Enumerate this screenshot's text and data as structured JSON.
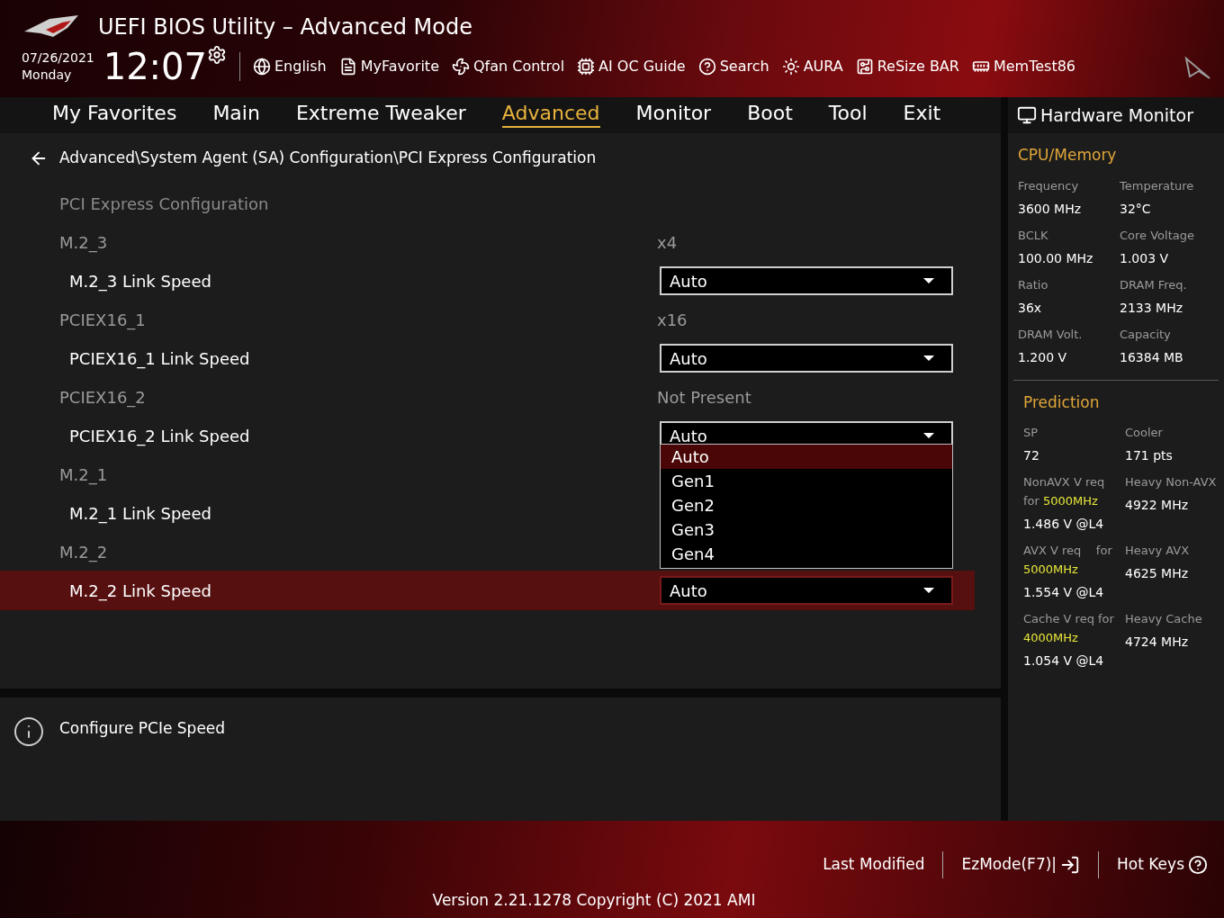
{
  "window": {
    "title": "UEFI BIOS Utility – Advanced Mode"
  },
  "clock": {
    "date": "07/26/2021",
    "weekday": "Monday",
    "time": "12:07"
  },
  "toolbar": [
    {
      "kind": "language",
      "label": "English"
    },
    {
      "kind": "favorite",
      "label": "MyFavorite"
    },
    {
      "kind": "fan",
      "label": "Qfan Control"
    },
    {
      "kind": "guide",
      "label": "AI OC Guide"
    },
    {
      "kind": "search",
      "label": "Search"
    },
    {
      "kind": "aura",
      "label": "AURA"
    },
    {
      "kind": "resize",
      "label": "ReSize BAR"
    },
    {
      "kind": "memtest",
      "label": "MemTest86"
    }
  ],
  "tabs": [
    {
      "label": "My Favorites",
      "selected": false
    },
    {
      "label": "Main",
      "selected": false
    },
    {
      "label": "Extreme Tweaker",
      "selected": false
    },
    {
      "label": "Advanced",
      "selected": true
    },
    {
      "label": "Monitor",
      "selected": false
    },
    {
      "label": "Boot",
      "selected": false
    },
    {
      "label": "Tool",
      "selected": false
    },
    {
      "label": "Exit",
      "selected": false
    }
  ],
  "breadcrumb": "Advanced\\System Agent (SA) Configuration\\PCI Express Configuration",
  "items": [
    {
      "kind": "title",
      "label": "PCI Express Configuration"
    },
    {
      "kind": "info",
      "label": "M.2_3",
      "value": "x4"
    },
    {
      "kind": "select",
      "label": "M.2_3 Link Speed",
      "value": "Auto",
      "selected": false
    },
    {
      "kind": "info",
      "label": "PCIEX16_1",
      "value": "x16"
    },
    {
      "kind": "select",
      "label": "PCIEX16_1 Link Speed",
      "value": "Auto",
      "selected": false
    },
    {
      "kind": "info",
      "label": "PCIEX16_2",
      "value": "Not Present"
    },
    {
      "kind": "select",
      "label": "PCIEX16_2 Link Speed",
      "value": "Auto",
      "selected": false,
      "options": [
        {
          "label": "Auto",
          "selected": true
        },
        {
          "label": "Gen1",
          "selected": false
        },
        {
          "label": "Gen2",
          "selected": false
        },
        {
          "label": "Gen3",
          "selected": false
        },
        {
          "label": "Gen4",
          "selected": false
        }
      ]
    },
    {
      "kind": "info",
      "label": "M.2_1"
    },
    {
      "kind": "select",
      "label": "M.2_1 Link Speed",
      "selected": false
    },
    {
      "kind": "info",
      "label": "M.2_2"
    },
    {
      "kind": "select",
      "label": "M.2_2 Link Speed",
      "value": "Auto",
      "selected": true
    }
  ],
  "help": "Configure PCIe Speed",
  "hardware_monitor": {
    "title": "Hardware Monitor",
    "sections": [
      {
        "title": "CPU/Memory",
        "cells": [
          {
            "label": "Frequency",
            "value": "3600 MHz"
          },
          {
            "label": "Temperature",
            "value": "32°C"
          },
          {
            "label": "BCLK",
            "value": "100.00 MHz"
          },
          {
            "label": "Core Voltage",
            "value": "1.003 V"
          },
          {
            "label": "Ratio",
            "value": "36x"
          },
          {
            "label": "DRAM Freq.",
            "value": "2133 MHz"
          },
          {
            "label": "DRAM Volt.",
            "value": "1.200 V"
          },
          {
            "label": "Capacity",
            "value": "16384 MB"
          }
        ]
      },
      {
        "title": "Prediction",
        "cells": [
          {
            "label": "SP",
            "value": "72"
          },
          {
            "label": "Cooler",
            "value": "171 pts"
          },
          {
            "label": "NonAVX V req for",
            "highlight": "5000MHz",
            "value": "1.486 V @L4"
          },
          {
            "label": "Heavy Non-AVX",
            "value": "4922 MHz"
          },
          {
            "label": "AVX V req    for",
            "highlight": "5000MHz",
            "value": "1.554 V @L4"
          },
          {
            "label": "Heavy AVX",
            "value": "4625 MHz"
          },
          {
            "label": "Cache V req for",
            "highlight": "4000MHz",
            "value": "1.054 V @L4"
          },
          {
            "label": "Heavy Cache",
            "value": "4724 MHz"
          }
        ]
      }
    ]
  },
  "footer": {
    "buttons": [
      {
        "kind": "last",
        "label": "Last Modified"
      },
      {
        "kind": "ezmode",
        "label": "EzMode(F7)|"
      },
      {
        "kind": "hotkeys",
        "label": "Hot Keys"
      }
    ],
    "version": "Version 2.21.1278 Copyright (C) 2021 AMI"
  }
}
